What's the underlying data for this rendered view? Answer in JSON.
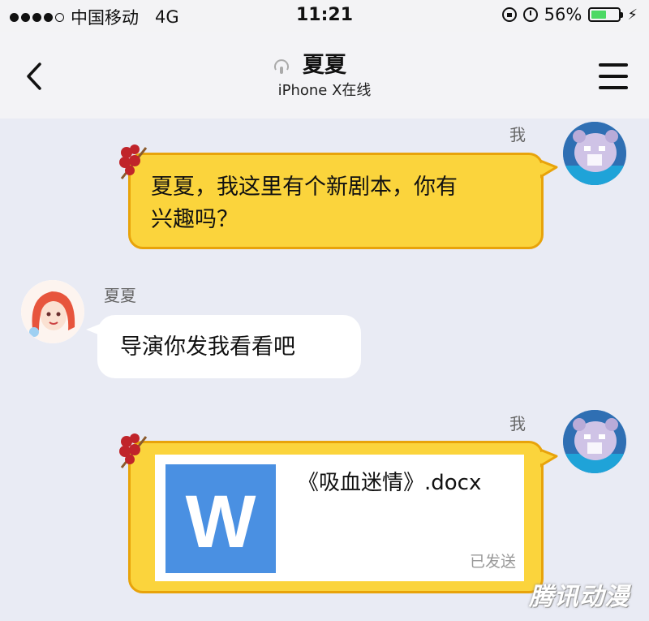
{
  "status_bar": {
    "carrier": "中国移动",
    "network": "4G",
    "time": "11:21",
    "battery_percent": "56%",
    "battery_level": 0.56,
    "battery_color": "#4cd964"
  },
  "nav": {
    "title": "夏夏",
    "subtitle": "iPhone X在线",
    "back_icon": "chevron-left-icon",
    "menu_icon": "hamburger-menu-icon"
  },
  "messages": [
    {
      "sender": "我",
      "text_lines": [
        "夏夏，我这里有个新剧本，你有",
        "兴趣吗？"
      ],
      "side": "right",
      "bubble_color": "#fbd43c"
    },
    {
      "sender": "夏夏",
      "text": "导演你发我看看吧",
      "side": "left",
      "bubble_color": "#ffffff"
    },
    {
      "sender": "我",
      "side": "right",
      "file": {
        "name": "《吸血迷情》.docx",
        "icon": "W",
        "status": "已发送"
      }
    }
  ],
  "watermark": "腾讯动漫"
}
